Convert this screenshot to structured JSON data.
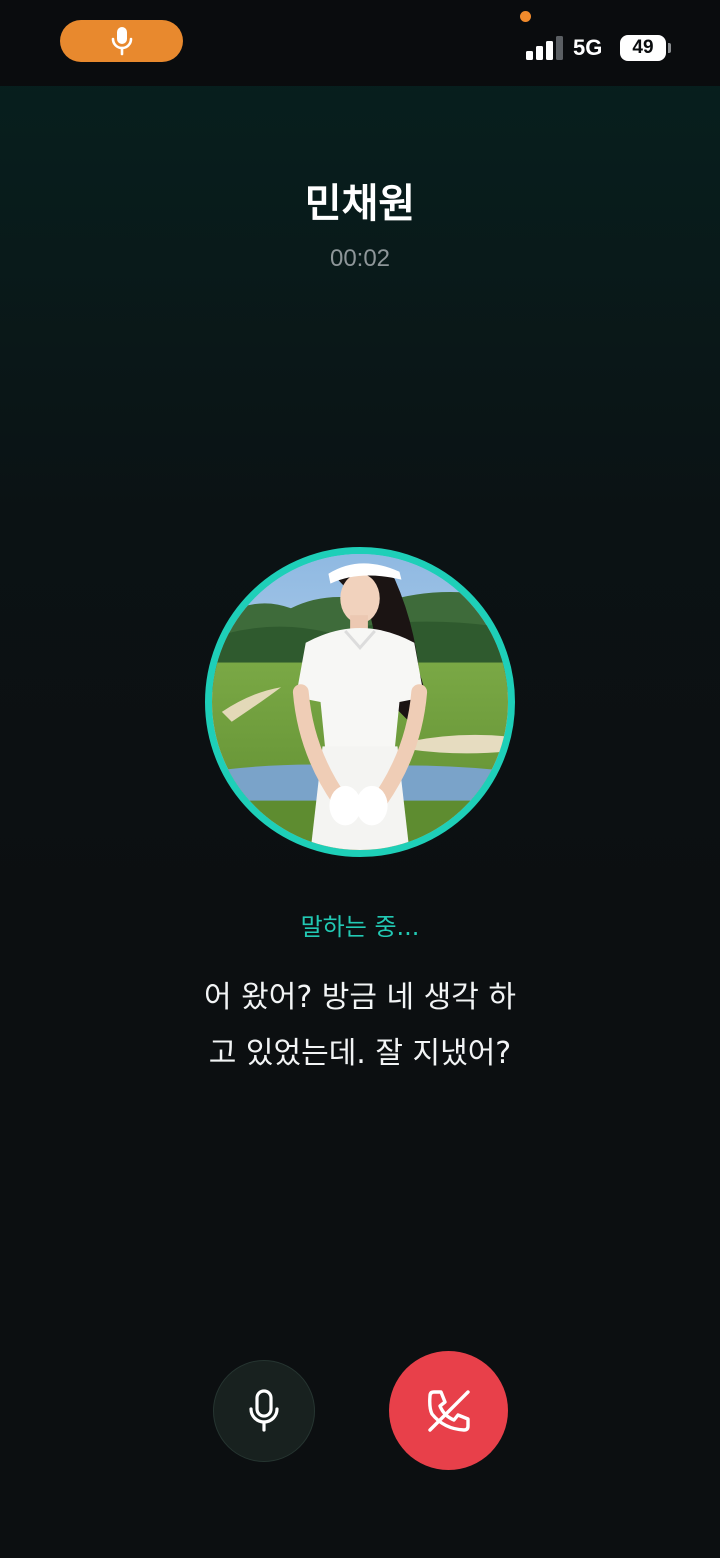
{
  "status_bar": {
    "network": "5G",
    "battery": "49",
    "icons": {
      "mic_indicator": "microphone-icon",
      "signal": "cellular-signal-icon",
      "battery": "battery-icon"
    },
    "colors": {
      "mic_pill": "#e8892e",
      "privacy_dot": "#f08a2c"
    }
  },
  "call": {
    "caller_name": "민채원",
    "timer": "00:02",
    "status": "말하는 중...",
    "transcript_line1": "어 왔어? 방금 네 생각 하",
    "transcript_line2": "고 있었는데. 잘 지냈어?"
  },
  "controls": {
    "mic_icon": "microphone-icon",
    "end_call_icon": "phone-hangup-icon",
    "colors": {
      "end_call": "#e8404a",
      "accent": "#1ecfb8"
    }
  }
}
